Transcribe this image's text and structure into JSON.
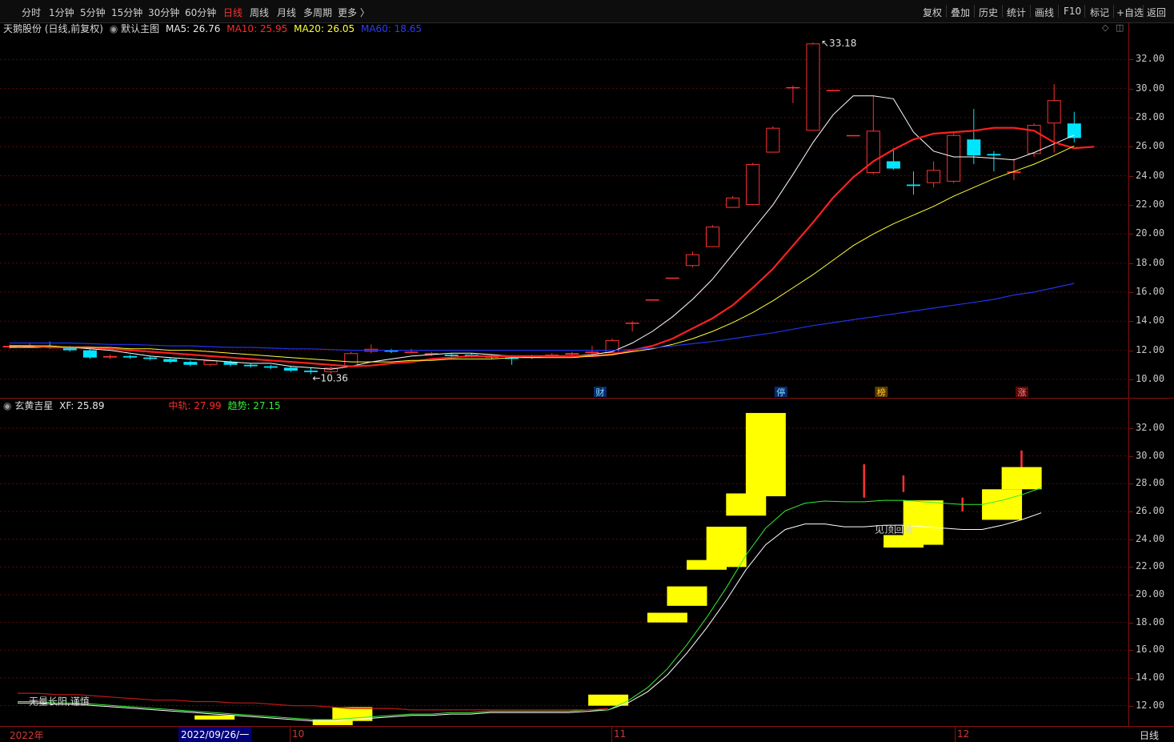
{
  "toolbar": {
    "periods": [
      "分时",
      "1分钟",
      "5分钟",
      "15分钟",
      "30分钟",
      "60分钟",
      "日线",
      "周线",
      "月线",
      "多周期",
      "更多 〉"
    ],
    "active_period": "日线",
    "right_buttons": [
      "复权",
      "叠加",
      "历史",
      "统计",
      "画线",
      "F10",
      "标记",
      "+自选",
      "返回"
    ]
  },
  "main_panel": {
    "title": "天鹅股份 (日线,前复权)",
    "style": "默认主图",
    "ma5": "MA5: 26.76",
    "ma10": "MA10: 25.95",
    "ma20": "MA20: 26.05",
    "ma60": "MA60: 18.65",
    "high_label": "33.18",
    "low_label": "10.36",
    "markers": [
      "财",
      "停",
      "榜",
      "涨"
    ],
    "y_ticks": [
      "32.00",
      "30.00",
      "28.00",
      "26.00",
      "24.00",
      "22.00",
      "20.00",
      "18.00",
      "16.00",
      "14.00",
      "12.00",
      "10.00"
    ]
  },
  "indicator_panel": {
    "title": "玄黄吉星",
    "xf": "XF: 25.89",
    "zhonggui": "中轨: 27.99",
    "qushi": "趋势: 27.15",
    "annotation1": "无量长阳,谨慎",
    "annotation2": "见顶回落",
    "y_ticks": [
      "32.00",
      "30.00",
      "28.00",
      "26.00",
      "24.00",
      "22.00",
      "20.00",
      "18.00",
      "16.00",
      "14.00",
      "12.00"
    ]
  },
  "footer": {
    "year": "2022年",
    "cursor_date": "2022/09/26/一",
    "months": [
      "10",
      "11",
      "12"
    ],
    "period_label": "日线"
  },
  "colors": {
    "up": "#ff3232",
    "down": "#00e5ff",
    "ma5": "#ffffff",
    "ma10": "#ff2020",
    "ma20": "#ffff33",
    "ma60": "#2233ee",
    "trend": "#33ee33",
    "xf_box": "#ffff00"
  },
  "chart_data": {
    "type": "candlestick",
    "title": "天鹅股份 (日线,前复权)",
    "ylim": [
      9.5,
      34
    ],
    "candles": [
      {
        "o": 12.2,
        "h": 12.4,
        "l": 12.1,
        "c": 12.3
      },
      {
        "o": 12.3,
        "h": 12.5,
        "l": 12.2,
        "c": 12.3
      },
      {
        "o": 12.3,
        "h": 12.6,
        "l": 12.1,
        "c": 12.2
      },
      {
        "o": 12.2,
        "h": 12.3,
        "l": 11.9,
        "c": 12.0
      },
      {
        "o": 12.0,
        "h": 12.1,
        "l": 11.4,
        "c": 11.5
      },
      {
        "o": 11.5,
        "h": 11.7,
        "l": 11.4,
        "c": 11.6
      },
      {
        "o": 11.6,
        "h": 11.7,
        "l": 11.4,
        "c": 11.5
      },
      {
        "o": 11.5,
        "h": 11.6,
        "l": 11.3,
        "c": 11.4
      },
      {
        "o": 11.4,
        "h": 11.5,
        "l": 11.1,
        "c": 11.2
      },
      {
        "o": 11.2,
        "h": 11.3,
        "l": 10.9,
        "c": 11.0
      },
      {
        "o": 11.0,
        "h": 11.3,
        "l": 10.9,
        "c": 11.3
      },
      {
        "o": 11.2,
        "h": 11.3,
        "l": 10.9,
        "c": 11.0
      },
      {
        "o": 11.0,
        "h": 11.1,
        "l": 10.8,
        "c": 10.9
      },
      {
        "o": 10.9,
        "h": 11.0,
        "l": 10.7,
        "c": 10.8
      },
      {
        "o": 10.8,
        "h": 10.9,
        "l": 10.5,
        "c": 10.6
      },
      {
        "o": 10.6,
        "h": 10.8,
        "l": 10.36,
        "c": 10.5
      },
      {
        "o": 10.5,
        "h": 10.9,
        "l": 10.4,
        "c": 10.8
      },
      {
        "o": 10.9,
        "h": 11.9,
        "l": 10.9,
        "c": 11.8
      },
      {
        "o": 11.9,
        "h": 12.4,
        "l": 11.8,
        "c": 12.1
      },
      {
        "o": 12.0,
        "h": 12.1,
        "l": 11.8,
        "c": 11.9
      },
      {
        "o": 11.9,
        "h": 12.1,
        "l": 11.8,
        "c": 11.9
      },
      {
        "o": 11.7,
        "h": 11.9,
        "l": 11.6,
        "c": 11.8
      },
      {
        "o": 11.7,
        "h": 11.8,
        "l": 11.5,
        "c": 11.6
      },
      {
        "o": 11.7,
        "h": 11.8,
        "l": 11.5,
        "c": 11.6
      },
      {
        "o": 11.6,
        "h": 11.7,
        "l": 11.4,
        "c": 11.5
      },
      {
        "o": 11.5,
        "h": 11.6,
        "l": 11.0,
        "c": 11.4
      },
      {
        "o": 11.5,
        "h": 11.7,
        "l": 11.4,
        "c": 11.6
      },
      {
        "o": 11.7,
        "h": 11.8,
        "l": 11.6,
        "c": 11.7
      },
      {
        "o": 11.7,
        "h": 11.9,
        "l": 11.6,
        "c": 11.8
      },
      {
        "o": 11.8,
        "h": 12.3,
        "l": 11.7,
        "c": 11.9
      },
      {
        "o": 11.8,
        "h": 12.8,
        "l": 11.8,
        "c": 12.7
      },
      {
        "o": 13.9,
        "h": 14.0,
        "l": 13.3,
        "c": 13.9
      },
      {
        "o": 15.5,
        "h": 15.5,
        "l": 15.5,
        "c": 15.5
      },
      {
        "o": 17.0,
        "h": 17.0,
        "l": 17.0,
        "c": 17.0
      },
      {
        "o": 17.8,
        "h": 18.8,
        "l": 17.7,
        "c": 18.6
      },
      {
        "o": 19.1,
        "h": 20.6,
        "l": 19.1,
        "c": 20.5
      },
      {
        "o": 21.8,
        "h": 22.6,
        "l": 21.8,
        "c": 22.5
      },
      {
        "o": 22.0,
        "h": 24.9,
        "l": 22.0,
        "c": 24.8
      },
      {
        "o": 25.6,
        "h": 27.4,
        "l": 25.6,
        "c": 27.3
      },
      {
        "o": 30.1,
        "h": 30.2,
        "l": 29.0,
        "c": 30.1
      },
      {
        "o": 27.1,
        "h": 33.18,
        "l": 27.1,
        "c": 33.1
      },
      {
        "o": 29.9,
        "h": 29.9,
        "l": 29.9,
        "c": 29.9
      },
      {
        "o": 26.8,
        "h": 26.8,
        "l": 26.8,
        "c": 26.8
      },
      {
        "o": 24.2,
        "h": 29.5,
        "l": 24.1,
        "c": 27.1
      },
      {
        "o": 25.0,
        "h": 25.9,
        "l": 24.4,
        "c": 24.5
      },
      {
        "o": 23.4,
        "h": 24.3,
        "l": 22.7,
        "c": 23.3
      },
      {
        "o": 23.5,
        "h": 25.0,
        "l": 23.2,
        "c": 24.4
      },
      {
        "o": 23.6,
        "h": 27.0,
        "l": 23.5,
        "c": 26.8
      },
      {
        "o": 26.5,
        "h": 28.6,
        "l": 24.8,
        "c": 25.4
      },
      {
        "o": 25.5,
        "h": 25.7,
        "l": 24.3,
        "c": 25.4
      },
      {
        "o": 24.2,
        "h": 25.2,
        "l": 23.7,
        "c": 24.3
      },
      {
        "o": 25.5,
        "h": 27.6,
        "l": 25.3,
        "c": 27.5
      },
      {
        "o": 27.6,
        "h": 30.3,
        "l": 25.6,
        "c": 29.2
      },
      {
        "o": 27.6,
        "h": 28.4,
        "l": 26.3,
        "c": 26.6
      }
    ],
    "series": [
      {
        "name": "MA5",
        "values": [
          12.2,
          12.2,
          12.2,
          12.2,
          12.1,
          12.0,
          11.8,
          11.6,
          11.5,
          11.4,
          11.3,
          11.2,
          11.1,
          11.1,
          10.9,
          10.8,
          10.7,
          10.9,
          11.2,
          11.4,
          11.6,
          11.7,
          11.8,
          11.8,
          11.7,
          11.6,
          11.5,
          11.6,
          11.6,
          11.7,
          11.9,
          12.5,
          13.3,
          14.3,
          15.5,
          16.9,
          18.6,
          20.3,
          22.0,
          24.1,
          26.3,
          28.2,
          29.5,
          29.5,
          29.3,
          27.0,
          25.7,
          25.3,
          25.3,
          25.2,
          25.1,
          25.6,
          26.2,
          26.8
        ]
      },
      {
        "name": "MA10",
        "values": [
          12.3,
          12.3,
          12.2,
          12.2,
          12.2,
          12.1,
          12.0,
          11.9,
          11.8,
          11.7,
          11.6,
          11.5,
          11.4,
          11.3,
          11.2,
          11.1,
          11.0,
          10.9,
          10.95,
          11.1,
          11.2,
          11.4,
          11.5,
          11.6,
          11.6,
          11.6,
          11.6,
          11.6,
          11.6,
          11.6,
          11.7,
          12.0,
          12.3,
          12.8,
          13.5,
          14.2,
          15.1,
          16.3,
          17.6,
          19.2,
          20.8,
          22.5,
          23.9,
          25.0,
          25.8,
          26.5,
          26.9,
          27.0,
          27.1,
          27.3,
          27.3,
          27.1,
          26.3,
          25.9,
          26.0
        ]
      },
      {
        "name": "MA20",
        "values": [
          12.3,
          12.3,
          12.3,
          12.2,
          12.2,
          12.2,
          12.1,
          12.1,
          12.0,
          12.0,
          11.9,
          11.8,
          11.7,
          11.6,
          11.5,
          11.4,
          11.3,
          11.2,
          11.2,
          11.2,
          11.3,
          11.3,
          11.4,
          11.4,
          11.4,
          11.5,
          11.5,
          11.5,
          11.5,
          11.6,
          11.7,
          11.9,
          12.1,
          12.4,
          12.8,
          13.3,
          13.9,
          14.6,
          15.4,
          16.3,
          17.2,
          18.2,
          19.2,
          20.0,
          20.7,
          21.3,
          21.9,
          22.6,
          23.2,
          23.8,
          24.3,
          24.8,
          25.4,
          26.05
        ]
      },
      {
        "name": "MA60",
        "values": [
          12.5,
          12.5,
          12.5,
          12.5,
          12.45,
          12.4,
          12.4,
          12.35,
          12.3,
          12.3,
          12.25,
          12.2,
          12.2,
          12.15,
          12.1,
          12.1,
          12.05,
          12.0,
          12.0,
          12.0,
          12.0,
          12.0,
          12.0,
          12.0,
          12.0,
          12.0,
          12.0,
          12.0,
          12.0,
          12.0,
          12.0,
          12.05,
          12.15,
          12.3,
          12.45,
          12.6,
          12.8,
          13.0,
          13.2,
          13.45,
          13.7,
          13.9,
          14.1,
          14.3,
          14.5,
          14.7,
          14.9,
          15.1,
          15.3,
          15.5,
          15.8,
          16.0,
          16.3,
          16.6
        ]
      }
    ],
    "indicator": {
      "name": "玄黄吉星",
      "ylim": [
        11,
        33.5
      ],
      "boxes": [
        {
          "i": 9,
          "lo": 11.0,
          "hi": 11.3
        },
        {
          "i": 15,
          "lo": 10.6,
          "hi": 11.0
        },
        {
          "i": 16,
          "lo": 10.9,
          "hi": 11.9
        },
        {
          "i": 29,
          "lo": 12.0,
          "hi": 12.8
        },
        {
          "i": 32,
          "lo": 18.0,
          "hi": 18.7
        },
        {
          "i": 33,
          "lo": 19.2,
          "hi": 20.6
        },
        {
          "i": 34,
          "lo": 21.8,
          "hi": 22.5
        },
        {
          "i": 35,
          "lo": 22.0,
          "hi": 24.9
        },
        {
          "i": 36,
          "lo": 25.7,
          "hi": 27.3
        },
        {
          "i": 37,
          "lo": 27.1,
          "hi": 33.1
        },
        {
          "i": 44,
          "lo": 23.4,
          "hi": 24.3
        },
        {
          "i": 45,
          "lo": 23.6,
          "hi": 26.8
        },
        {
          "i": 49,
          "lo": 25.4,
          "hi": 27.6
        },
        {
          "i": 50,
          "lo": 27.6,
          "hi": 29.2
        }
      ],
      "white": [
        12.2,
        12.2,
        12.1,
        12.1,
        12.0,
        11.9,
        11.8,
        11.7,
        11.6,
        11.5,
        11.4,
        11.3,
        11.2,
        11.1,
        11.0,
        10.9,
        10.9,
        11.0,
        11.1,
        11.2,
        11.3,
        11.3,
        11.4,
        11.4,
        11.5,
        11.5,
        11.5,
        11.5,
        11.5,
        11.6,
        11.7,
        12.2,
        13.0,
        14.2,
        15.8,
        17.6,
        19.6,
        21.8,
        23.6,
        24.7,
        25.1,
        25.1,
        24.9,
        24.9,
        25.0,
        25.0,
        24.9,
        24.8,
        24.7,
        24.7,
        25.0,
        25.4,
        25.9
      ],
      "red": [
        12.9,
        12.9,
        12.8,
        12.8,
        12.7,
        12.6,
        12.5,
        12.4,
        12.4,
        12.3,
        12.3,
        12.2,
        12.2,
        12.1,
        12.0,
        12.0,
        11.9,
        11.8,
        11.8,
        11.8,
        11.7,
        11.7,
        11.7,
        11.7,
        11.7,
        11.7,
        11.7,
        11.7,
        11.7,
        11.7,
        11.8
      ]
    }
  }
}
